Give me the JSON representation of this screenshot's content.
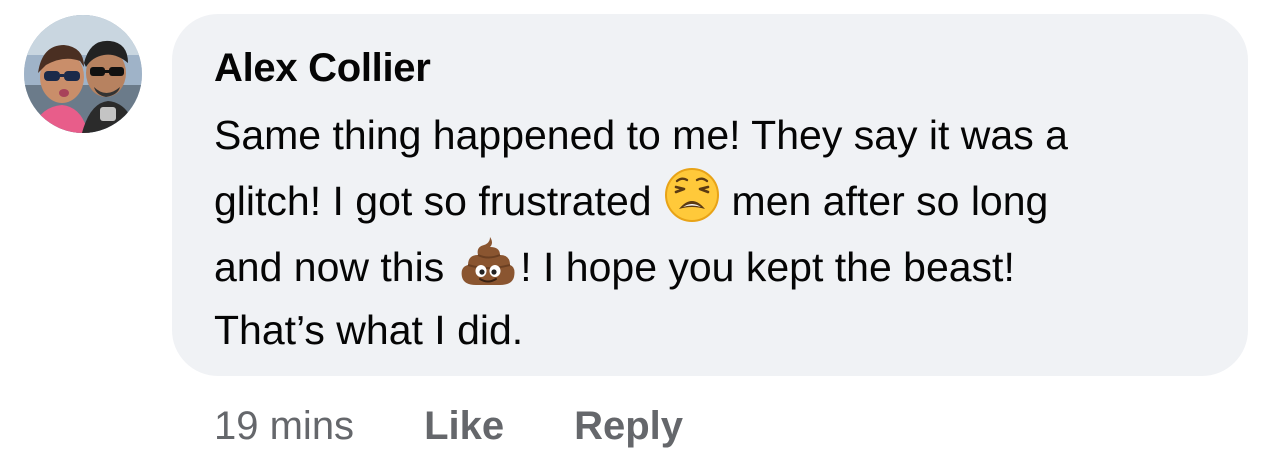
{
  "comment": {
    "author": "Alex Collier",
    "lines": [
      {
        "text": "Same thing happened to me! They say it was a"
      },
      {
        "before": "glitch! I got so frustrated",
        "emoji": "weary-face-emoji",
        "after": "men after so long"
      },
      {
        "before": "and now this",
        "emoji": "pile-of-poo-emoji",
        "after": "! I hope you kept the beast!"
      },
      {
        "text": "That’s what I did."
      }
    ],
    "avatar_icon": "profile-photo"
  },
  "actions": {
    "timestamp": "19 mins",
    "like_label": "Like",
    "reply_label": "Reply"
  },
  "colors": {
    "bubble": "#f0f2f5",
    "text": "#050505",
    "meta": "#65676b"
  }
}
